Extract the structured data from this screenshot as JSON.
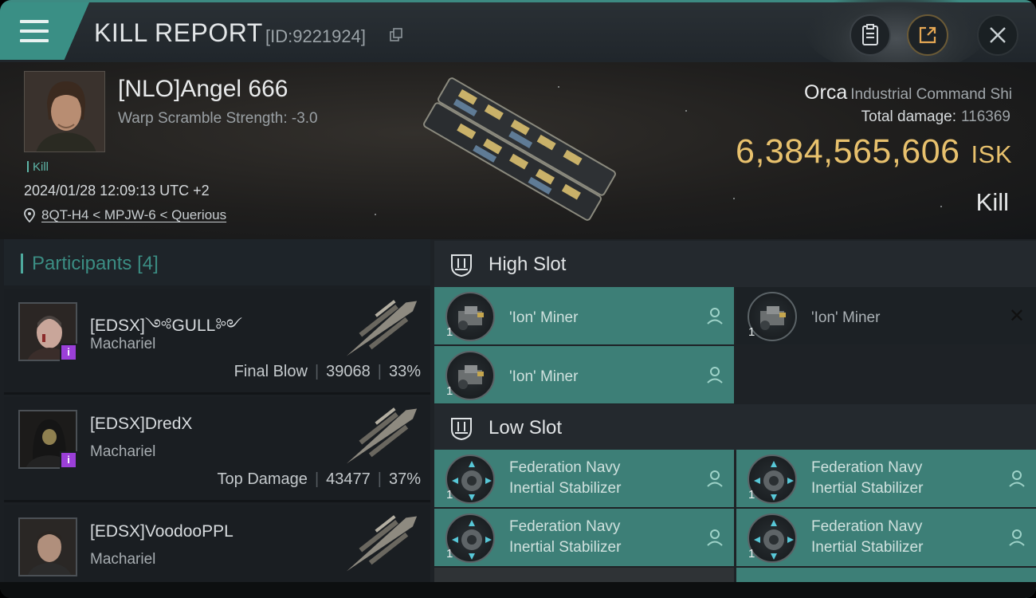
{
  "header": {
    "title": "KILL REPORT",
    "report_id": "[ID:9221924]"
  },
  "victim": {
    "pilot": "[NLO]Angel 666",
    "warp_scramble": "Warp Scramble Strength: -3.0",
    "tag": "Kill",
    "datetime": "2024/01/28 12:09:13 UTC +2",
    "location": "8QT-H4 < MPJW-6 < Querious",
    "ship_name": "Orca",
    "ship_class": "Industrial Command Shi",
    "total_damage_label": "Total damage:",
    "total_damage": "116369",
    "isk_value": "6,384,565,606",
    "isk_unit": "ISK",
    "result": "Kill"
  },
  "participants": {
    "title": "Participants",
    "count": "[4]",
    "rows": [
      {
        "name": "[EDSX]༺GULL༻",
        "ship": "Machariel",
        "stat_label": "Final Blow",
        "damage": "39068",
        "percent": "33%"
      },
      {
        "name": "[EDSX]DredX",
        "ship": "Machariel",
        "stat_label": "Top Damage",
        "damage": "43477",
        "percent": "37%"
      },
      {
        "name": "[EDSX]VoodooPPL",
        "ship": "Machariel"
      }
    ]
  },
  "fitting": {
    "high_slot_label": "High Slot",
    "low_slot_label": "Low Slot",
    "high": [
      {
        "name": "'Ion' Miner",
        "qty": "1"
      },
      {
        "name": "'Ion' Miner",
        "qty": "1"
      },
      {
        "name": "'Ion' Miner",
        "qty": "1"
      }
    ],
    "low": [
      {
        "line1": "Federation Navy",
        "line2": "Inertial Stabilizer",
        "qty": "1"
      },
      {
        "line1": "Federation Navy",
        "line2": "Inertial Stabilizer",
        "qty": "1"
      },
      {
        "line1": "Federation Navy",
        "line2": "Inertial Stabilizer",
        "qty": "1"
      },
      {
        "line1": "Federation Navy",
        "line2": "Inertial Stabilizer",
        "qty": "1"
      }
    ]
  },
  "colors": {
    "accent_teal": "#3d7f77",
    "isk_gold": "#e8c16d",
    "badge_purple": "#9b3fd8"
  }
}
